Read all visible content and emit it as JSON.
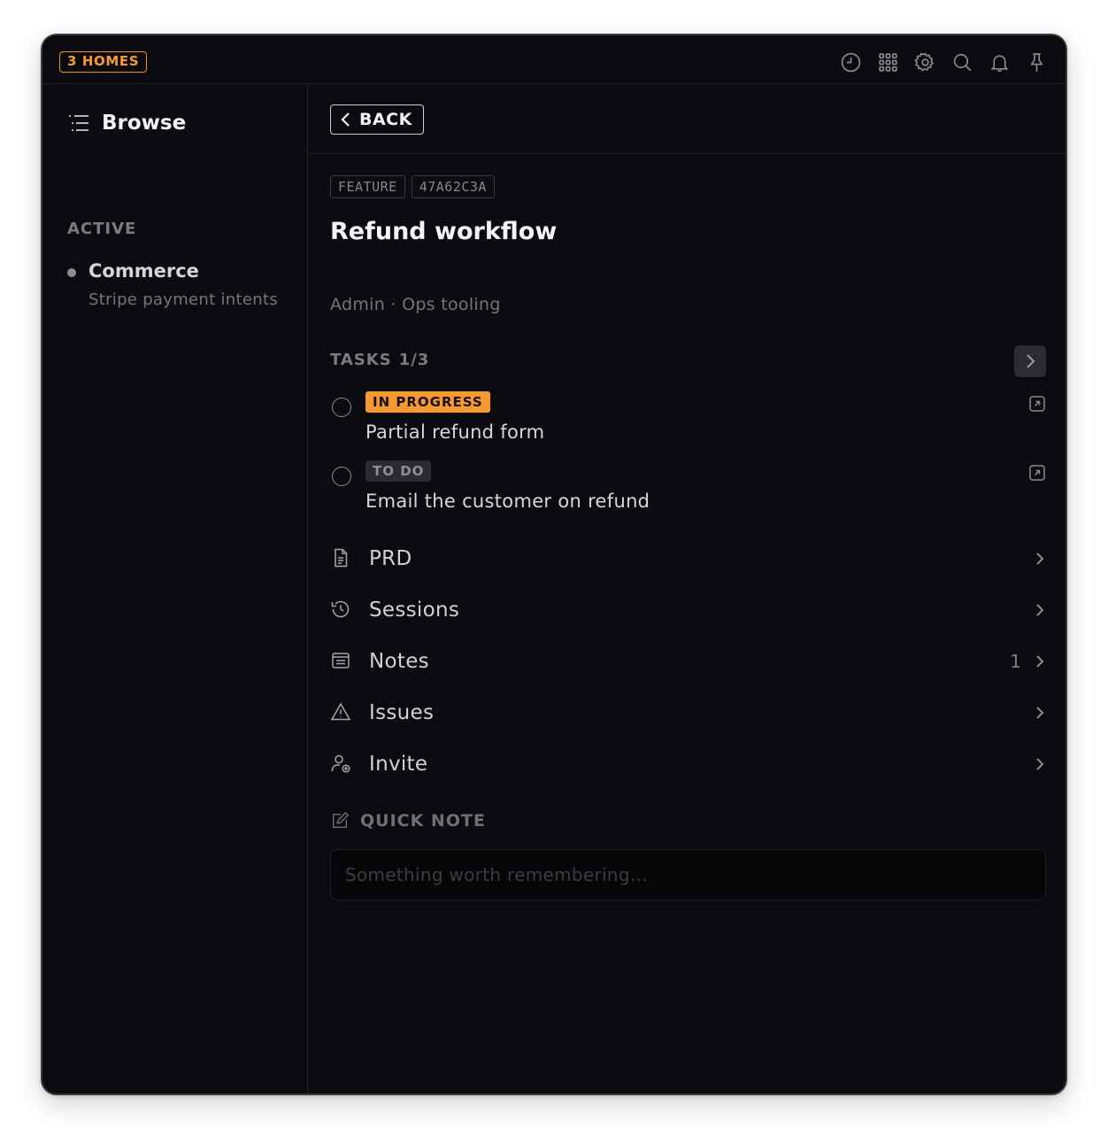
{
  "window": {
    "homes_badge": "3 HOMES",
    "top_icons": [
      "clock-icon",
      "grid-icon",
      "gear-icon",
      "search-icon",
      "bell-icon",
      "pin-icon"
    ]
  },
  "sidebar": {
    "browse_label": "Browse",
    "section_label": "ACTIVE",
    "projects": [
      {
        "name": "Commerce",
        "description": "Stripe payment intents"
      }
    ]
  },
  "main": {
    "back_label": "BACK",
    "tags": [
      "FEATURE",
      "47A62C3A"
    ],
    "title": "Refund workflow",
    "subtitle": "Admin · Ops tooling",
    "tasks": {
      "label": "TASKS",
      "count": "1/3",
      "items": [
        {
          "status": "IN PROGRESS",
          "name": "Partial refund form"
        },
        {
          "status": "TO DO",
          "name": "Email the customer on refund"
        }
      ]
    },
    "menu": [
      {
        "label": "PRD",
        "icon": "document-icon",
        "count": ""
      },
      {
        "label": "Sessions",
        "icon": "history-icon",
        "count": ""
      },
      {
        "label": "Notes",
        "icon": "notes-icon",
        "count": "1"
      },
      {
        "label": "Issues",
        "icon": "warning-icon",
        "count": ""
      },
      {
        "label": "Invite",
        "icon": "add-user-icon",
        "count": ""
      }
    ],
    "quick_note": {
      "label": "QUICK NOTE",
      "placeholder": "Something worth remembering..."
    }
  },
  "colors": {
    "accent": "#f59a33",
    "background": "#0c0c10"
  }
}
